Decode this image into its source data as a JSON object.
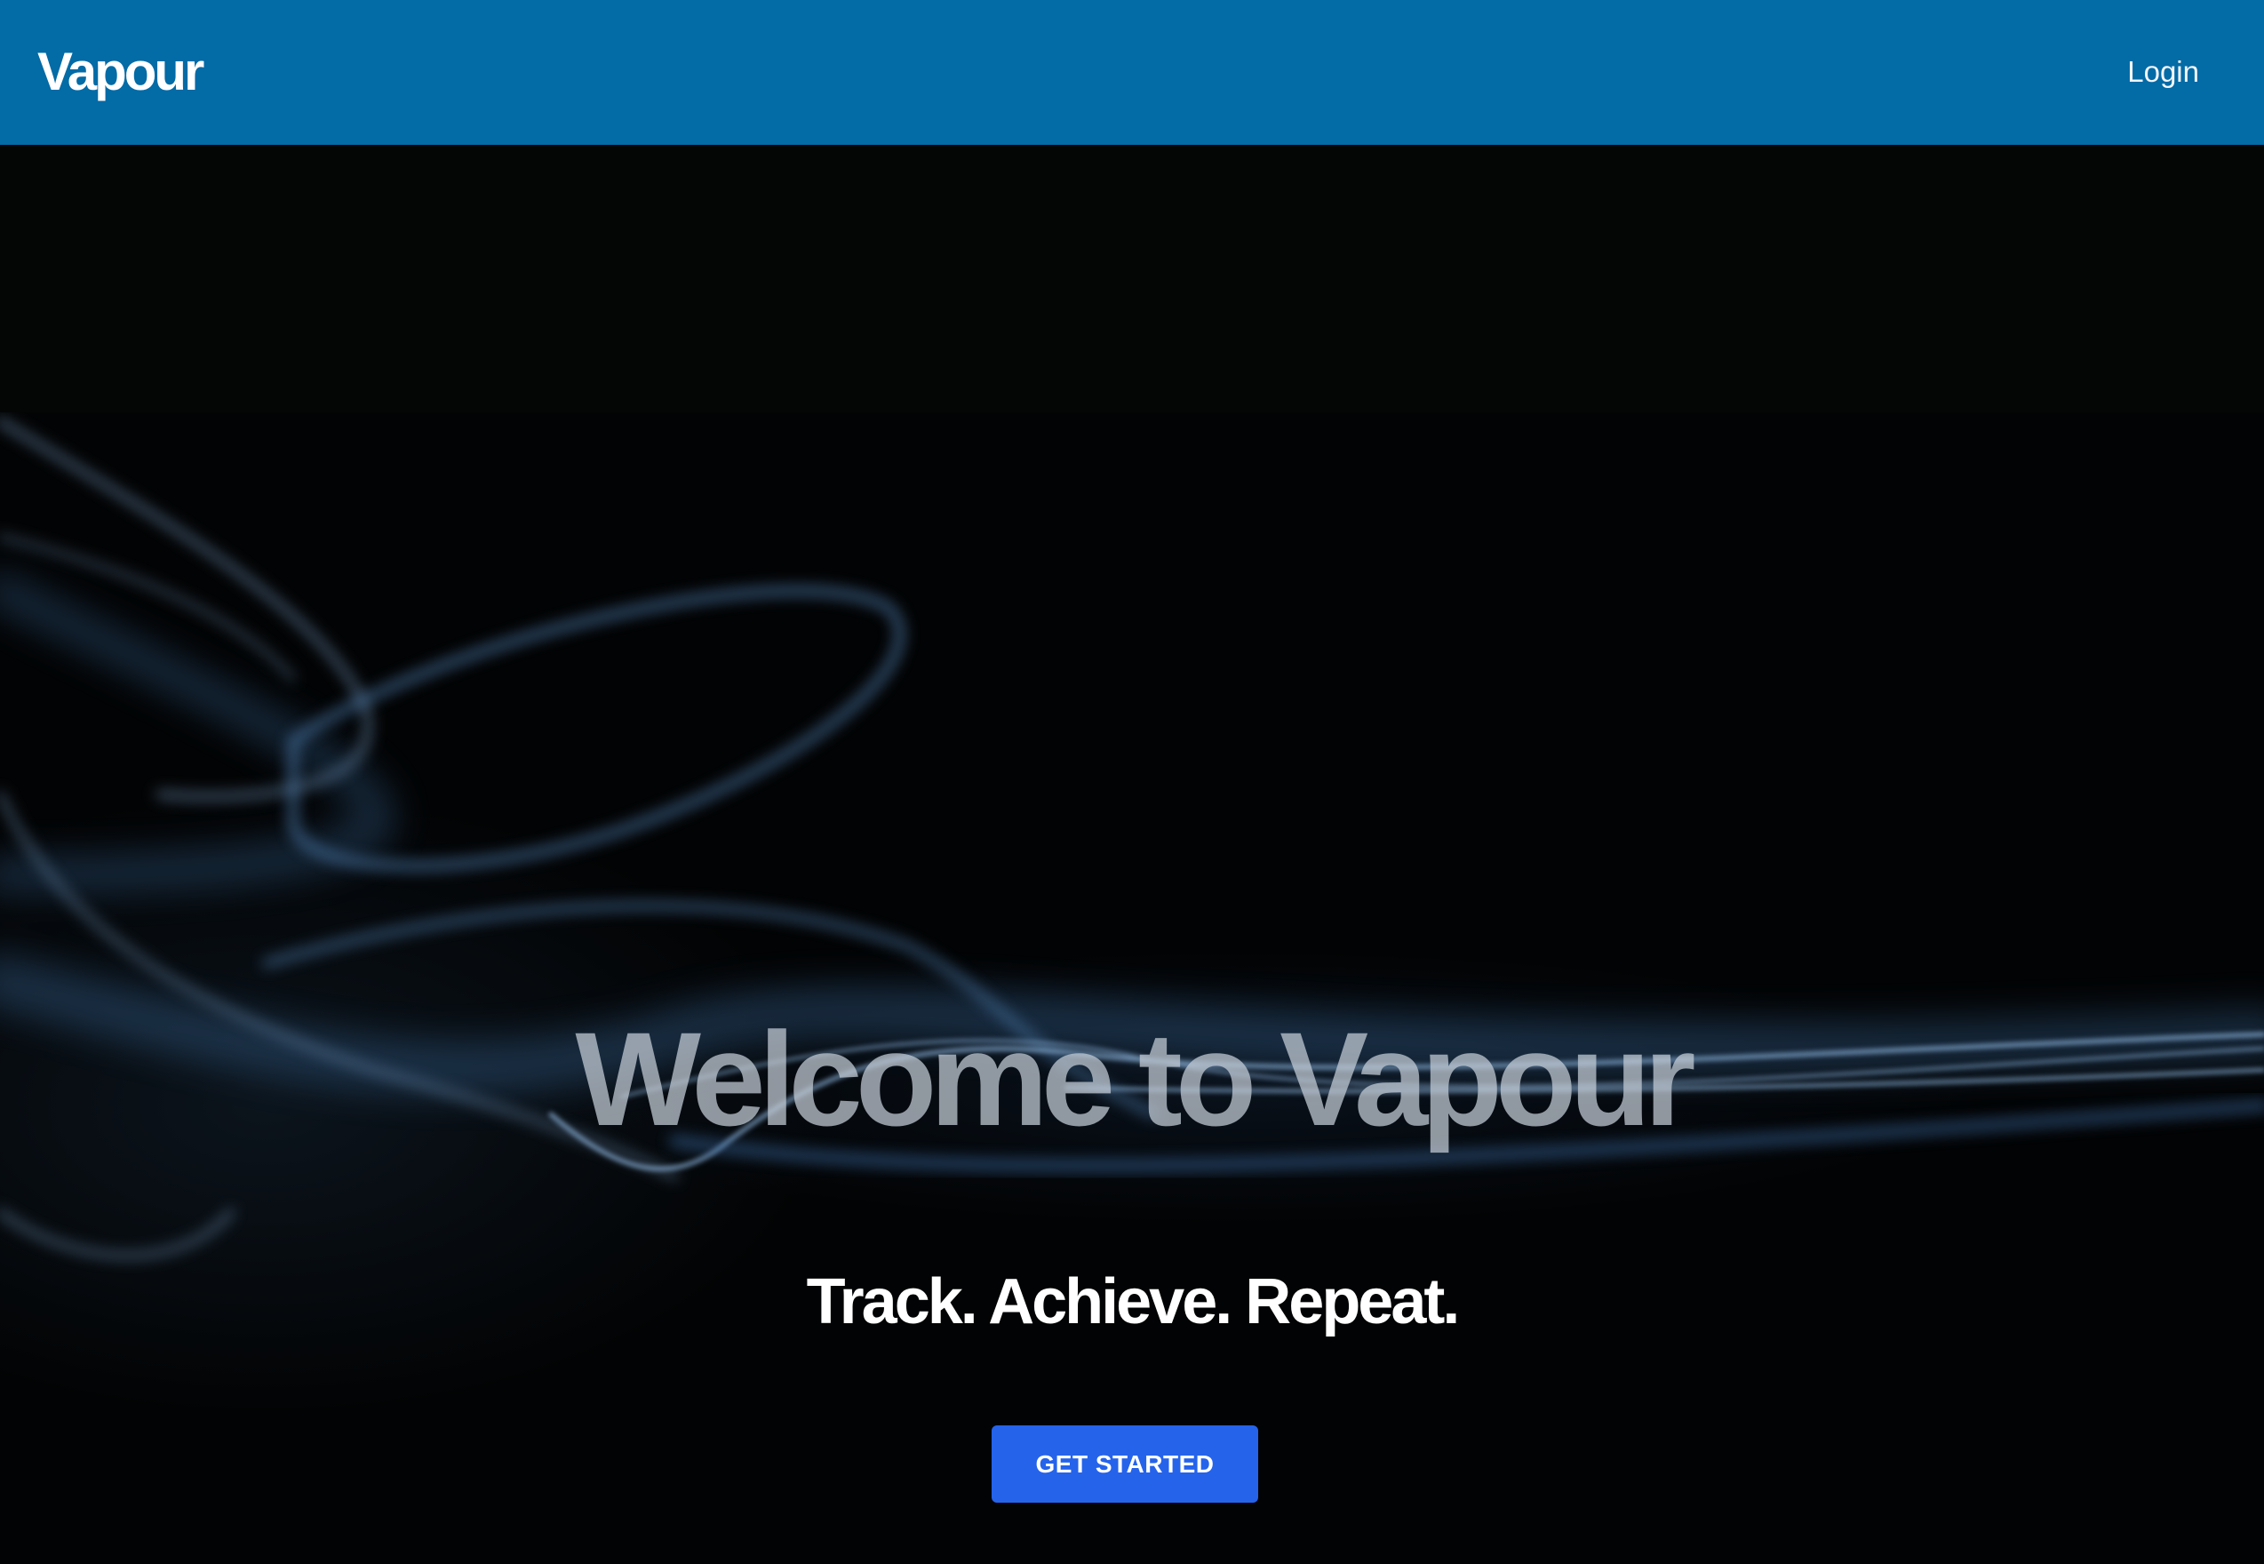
{
  "navbar": {
    "brand": "Vapour",
    "login_label": "Login",
    "background_color": "#036ba6"
  },
  "hero": {
    "headline": "Welcome to Vapour",
    "tagline": "Track. Achieve. Repeat.",
    "cta_label": "GET STARTED",
    "cta_color": "#2563eb",
    "background_image": "blue-smoke-on-black"
  }
}
